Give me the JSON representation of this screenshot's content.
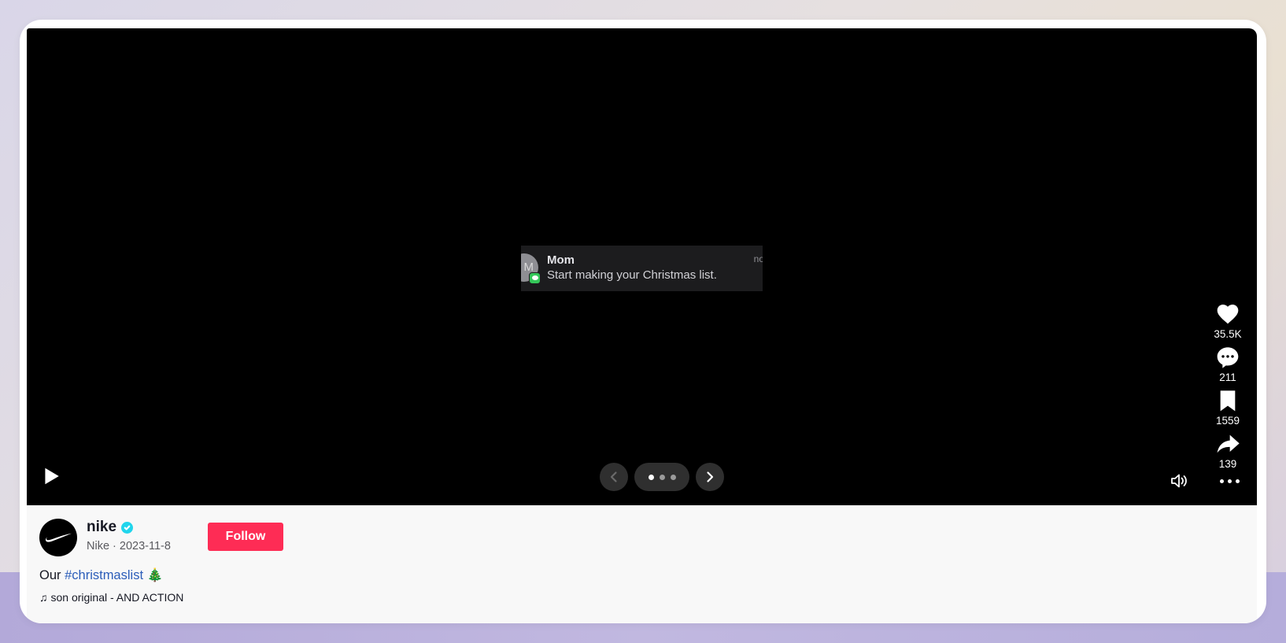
{
  "video": {
    "notification": {
      "avatar_initial": "M",
      "sender": "Mom",
      "message": "Start making your Christmas list.",
      "time": "no"
    },
    "actions": [
      {
        "name": "like",
        "icon": "heart-icon",
        "count": "35.5K"
      },
      {
        "name": "comment",
        "icon": "comment-icon",
        "count": "211"
      },
      {
        "name": "save",
        "icon": "bookmark-icon",
        "count": "1559"
      },
      {
        "name": "share",
        "icon": "share-icon",
        "count": "139"
      }
    ],
    "controls": {
      "play_icon": "play-icon",
      "prev_icon": "chevron-left-icon",
      "next_icon": "chevron-right-icon",
      "volume_icon": "volume-icon",
      "more_icon": "more-horizontal-icon",
      "slides_total": 3,
      "slide_active": 1
    }
  },
  "author": {
    "username": "nike",
    "verified": true,
    "display_name": "Nike",
    "date": "2023-11-8",
    "meta": "Nike · 2023-11-8",
    "follow_label": "Follow"
  },
  "post": {
    "caption_prefix": "Our ",
    "hashtag": "#christmaslist",
    "emoji": "🎄",
    "music": "son original - AND ACTION",
    "music_icon": "♫"
  },
  "colors": {
    "accent": "#fe2c55",
    "verified": "#20d5ec",
    "hashtag": "#2b5db9"
  }
}
